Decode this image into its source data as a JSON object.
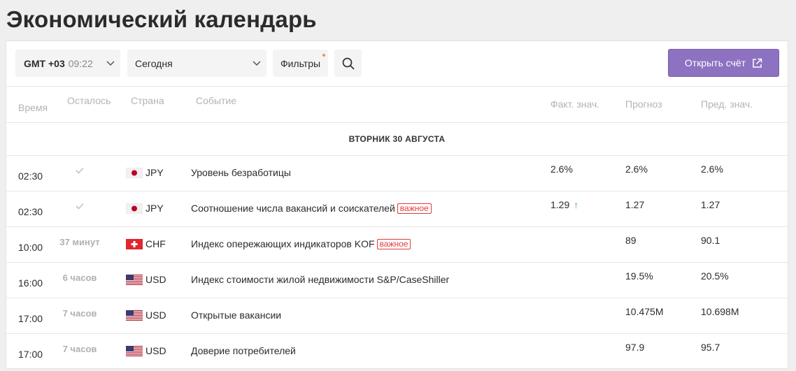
{
  "page": {
    "title": "Экономический календарь"
  },
  "toolbar": {
    "timezone_label": "GMT +03",
    "timezone_time": "09:22",
    "date_value": "Сегодня",
    "filters_label": "Фильтры",
    "open_account_label": "Открыть счёт"
  },
  "colors": {
    "accent": "#8c72c0",
    "badge": "#e23b3b",
    "up": "#3bb25e",
    "filter_dot": "#f0933a"
  },
  "table": {
    "headers": {
      "time": "Время",
      "remaining": "Осталось",
      "country": "Страна",
      "event": "Событие",
      "actual": "Факт. знач.",
      "forecast": "Прогноз",
      "previous": "Пред. знач."
    },
    "date_label": "ВТОРНИК 30 АВГУСТА",
    "important_label": "важное",
    "rows": [
      {
        "time": "02:30",
        "remaining": "",
        "done": true,
        "flag": "jp-flag-icon",
        "currency": "JPY",
        "event": "Уровень безработицы",
        "important": false,
        "actual": "2.6%",
        "actual_up": false,
        "forecast": "2.6%",
        "previous": "2.6%"
      },
      {
        "time": "02:30",
        "remaining": "",
        "done": true,
        "flag": "jp-flag-icon",
        "currency": "JPY",
        "event": "Соотношение числа вакансий и соискателей",
        "important": true,
        "actual": "1.29",
        "actual_up": true,
        "forecast": "1.27",
        "previous": "1.27"
      },
      {
        "time": "10:00",
        "remaining": "37 минут",
        "done": false,
        "flag": "ch-flag-icon",
        "currency": "CHF",
        "event": "Индекс опережающих индикаторов KOF",
        "important": true,
        "actual": "",
        "actual_up": false,
        "forecast": "89",
        "previous": "90.1"
      },
      {
        "time": "16:00",
        "remaining": "6 часов",
        "done": false,
        "flag": "us-flag-icon",
        "currency": "USD",
        "event": "Индекс стоимости жилой недвижимости S&P/CaseShiller",
        "important": false,
        "actual": "",
        "actual_up": false,
        "forecast": "19.5%",
        "previous": "20.5%"
      },
      {
        "time": "17:00",
        "remaining": "7 часов",
        "done": false,
        "flag": "us-flag-icon",
        "currency": "USD",
        "event": "Открытые вакансии",
        "important": false,
        "actual": "",
        "actual_up": false,
        "forecast": "10.475M",
        "previous": "10.698M"
      },
      {
        "time": "17:00",
        "remaining": "7 часов",
        "done": false,
        "flag": "us-flag-icon",
        "currency": "USD",
        "event": "Доверие потребителей",
        "important": false,
        "actual": "",
        "actual_up": false,
        "forecast": "97.9",
        "previous": "95.7"
      }
    ]
  }
}
